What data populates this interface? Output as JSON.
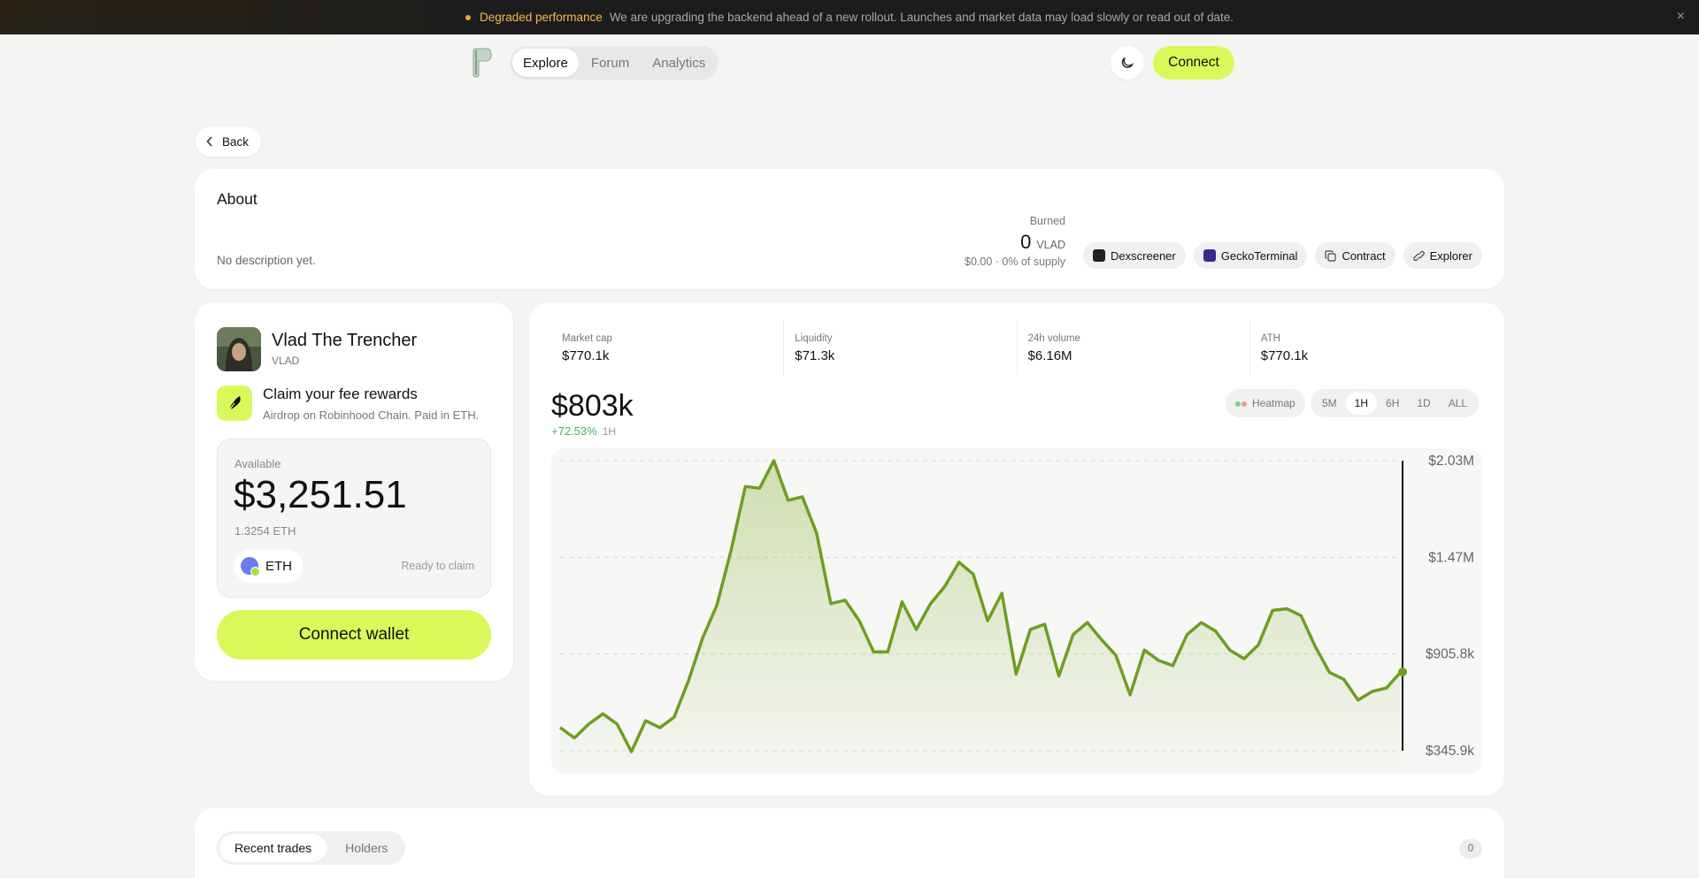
{
  "banner": {
    "title": "Degraded performance",
    "message": "We are upgrading the backend ahead of a new rollout. Launches and market data may load slowly or read out of date.",
    "close": "×"
  },
  "nav": {
    "tabs": [
      "Explore",
      "Forum",
      "Analytics"
    ],
    "active": "Explore",
    "connect": "Connect"
  },
  "back": "Back",
  "about": {
    "title": "About",
    "description": "No description yet.",
    "burned_label": "Burned",
    "burned_value": "0",
    "burned_unit": "VLAD",
    "burned_sub": "$0.00 · 0% of supply",
    "links": [
      "Dexscreener",
      "GeckoTerminal",
      "Contract",
      "Explorer"
    ]
  },
  "token": {
    "name": "Vlad The Trencher",
    "symbol": "VLAD",
    "claim_title": "Claim your fee rewards",
    "claim_sub": "Airdrop on Robinhood Chain. Paid in ETH.",
    "available_label": "Available",
    "available_amount": "$3,251.51",
    "available_eth": "1.3254 ETH",
    "chip": "ETH",
    "ready": "Ready to claim",
    "wallet_button": "Connect wallet"
  },
  "stats": [
    {
      "label": "Market cap",
      "value": "$770.1k"
    },
    {
      "label": "Liquidity",
      "value": "$71.3k"
    },
    {
      "label": "24h volume",
      "value": "$6.16M"
    },
    {
      "label": "ATH",
      "value": "$770.1k"
    }
  ],
  "price": {
    "value": "$803k",
    "change": "+72.53%",
    "period": "1H"
  },
  "controls": {
    "heatmap": "Heatmap",
    "timeframes": [
      "5M",
      "1H",
      "6H",
      "1D",
      "ALL"
    ],
    "active": "1H"
  },
  "colors": {
    "accent": "#d9f95a",
    "line": "#6e9e22",
    "positive": "#44b35b"
  },
  "chart_data": {
    "type": "area",
    "y_ticks": [
      "$2.03M",
      "$1.47M",
      "$905.8k",
      "$345.9k"
    ],
    "ylim": [
      345900,
      2030000
    ],
    "values": [
      480000,
      420000,
      500000,
      560000,
      500000,
      340000,
      520000,
      480000,
      540000,
      750000,
      1000000,
      1190000,
      1510000,
      1880000,
      1870000,
      2030000,
      1800000,
      1820000,
      1610000,
      1200000,
      1220000,
      1100000,
      920000,
      920000,
      1210000,
      1050000,
      1200000,
      1300000,
      1440000,
      1370000,
      1100000,
      1260000,
      790000,
      1050000,
      1080000,
      780000,
      1020000,
      1090000,
      990000,
      900000,
      670000,
      930000,
      870000,
      840000,
      1020000,
      1090000,
      1040000,
      930000,
      880000,
      960000,
      1160000,
      1170000,
      1130000,
      950000,
      800000,
      760000,
      640000,
      690000,
      710000,
      803000
    ],
    "grid": true
  },
  "trades": {
    "tabs": [
      "Recent trades",
      "Holders"
    ],
    "active": "Recent trades",
    "count": "0"
  }
}
